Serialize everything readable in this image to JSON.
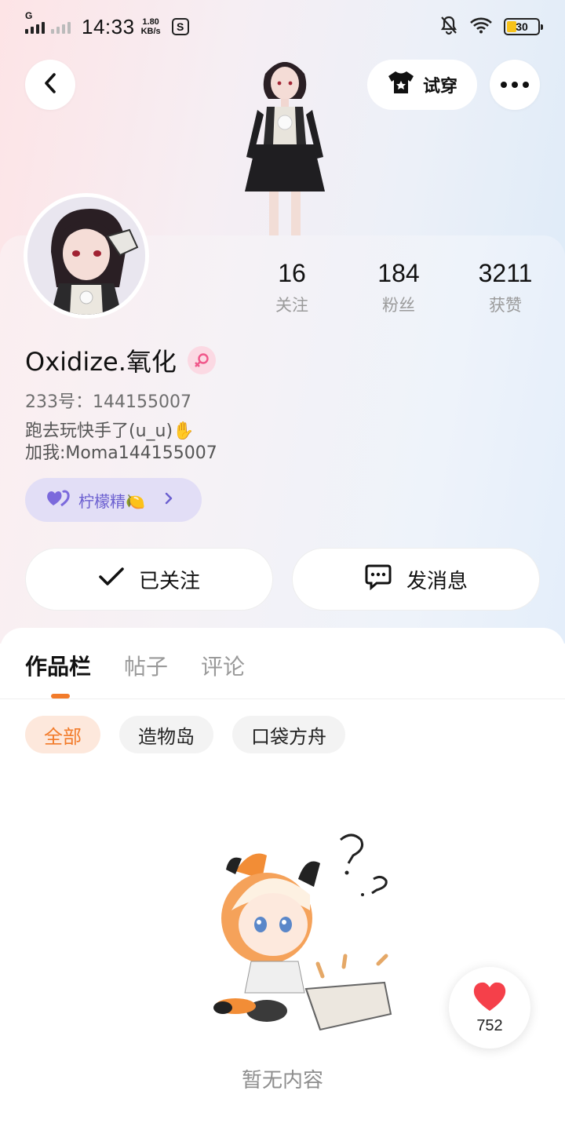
{
  "status_bar": {
    "network": "G",
    "time": "14:33",
    "speed_value": "1.80",
    "speed_unit": "KB/s",
    "battery": "30"
  },
  "header": {
    "tryon_label": "试穿"
  },
  "profile": {
    "stats": [
      {
        "value": "16",
        "label": "关注"
      },
      {
        "value": "184",
        "label": "粉丝"
      },
      {
        "value": "3211",
        "label": "获赞"
      }
    ],
    "username": "Oxidize.氧化",
    "uid": "233号：144155007",
    "bio_lines": [
      "跑去玩快手了(u_u)✋",
      "加我:Moma144155007"
    ],
    "tag_label": "柠檬精🍋",
    "follow_label": "已关注",
    "message_label": "发消息"
  },
  "tabs": [
    {
      "label": "作品栏",
      "active": true
    },
    {
      "label": "帖子",
      "active": false
    },
    {
      "label": "评论",
      "active": false
    }
  ],
  "chips": [
    {
      "label": "全部",
      "active": true
    },
    {
      "label": "造物岛",
      "active": false
    },
    {
      "label": "口袋方舟",
      "active": false
    }
  ],
  "empty_text": "暂无内容",
  "like_fab": {
    "count": "752"
  },
  "colors": {
    "accent": "#f27b2a",
    "tag_text": "#6b5fd0",
    "heart": "#f5404a"
  }
}
